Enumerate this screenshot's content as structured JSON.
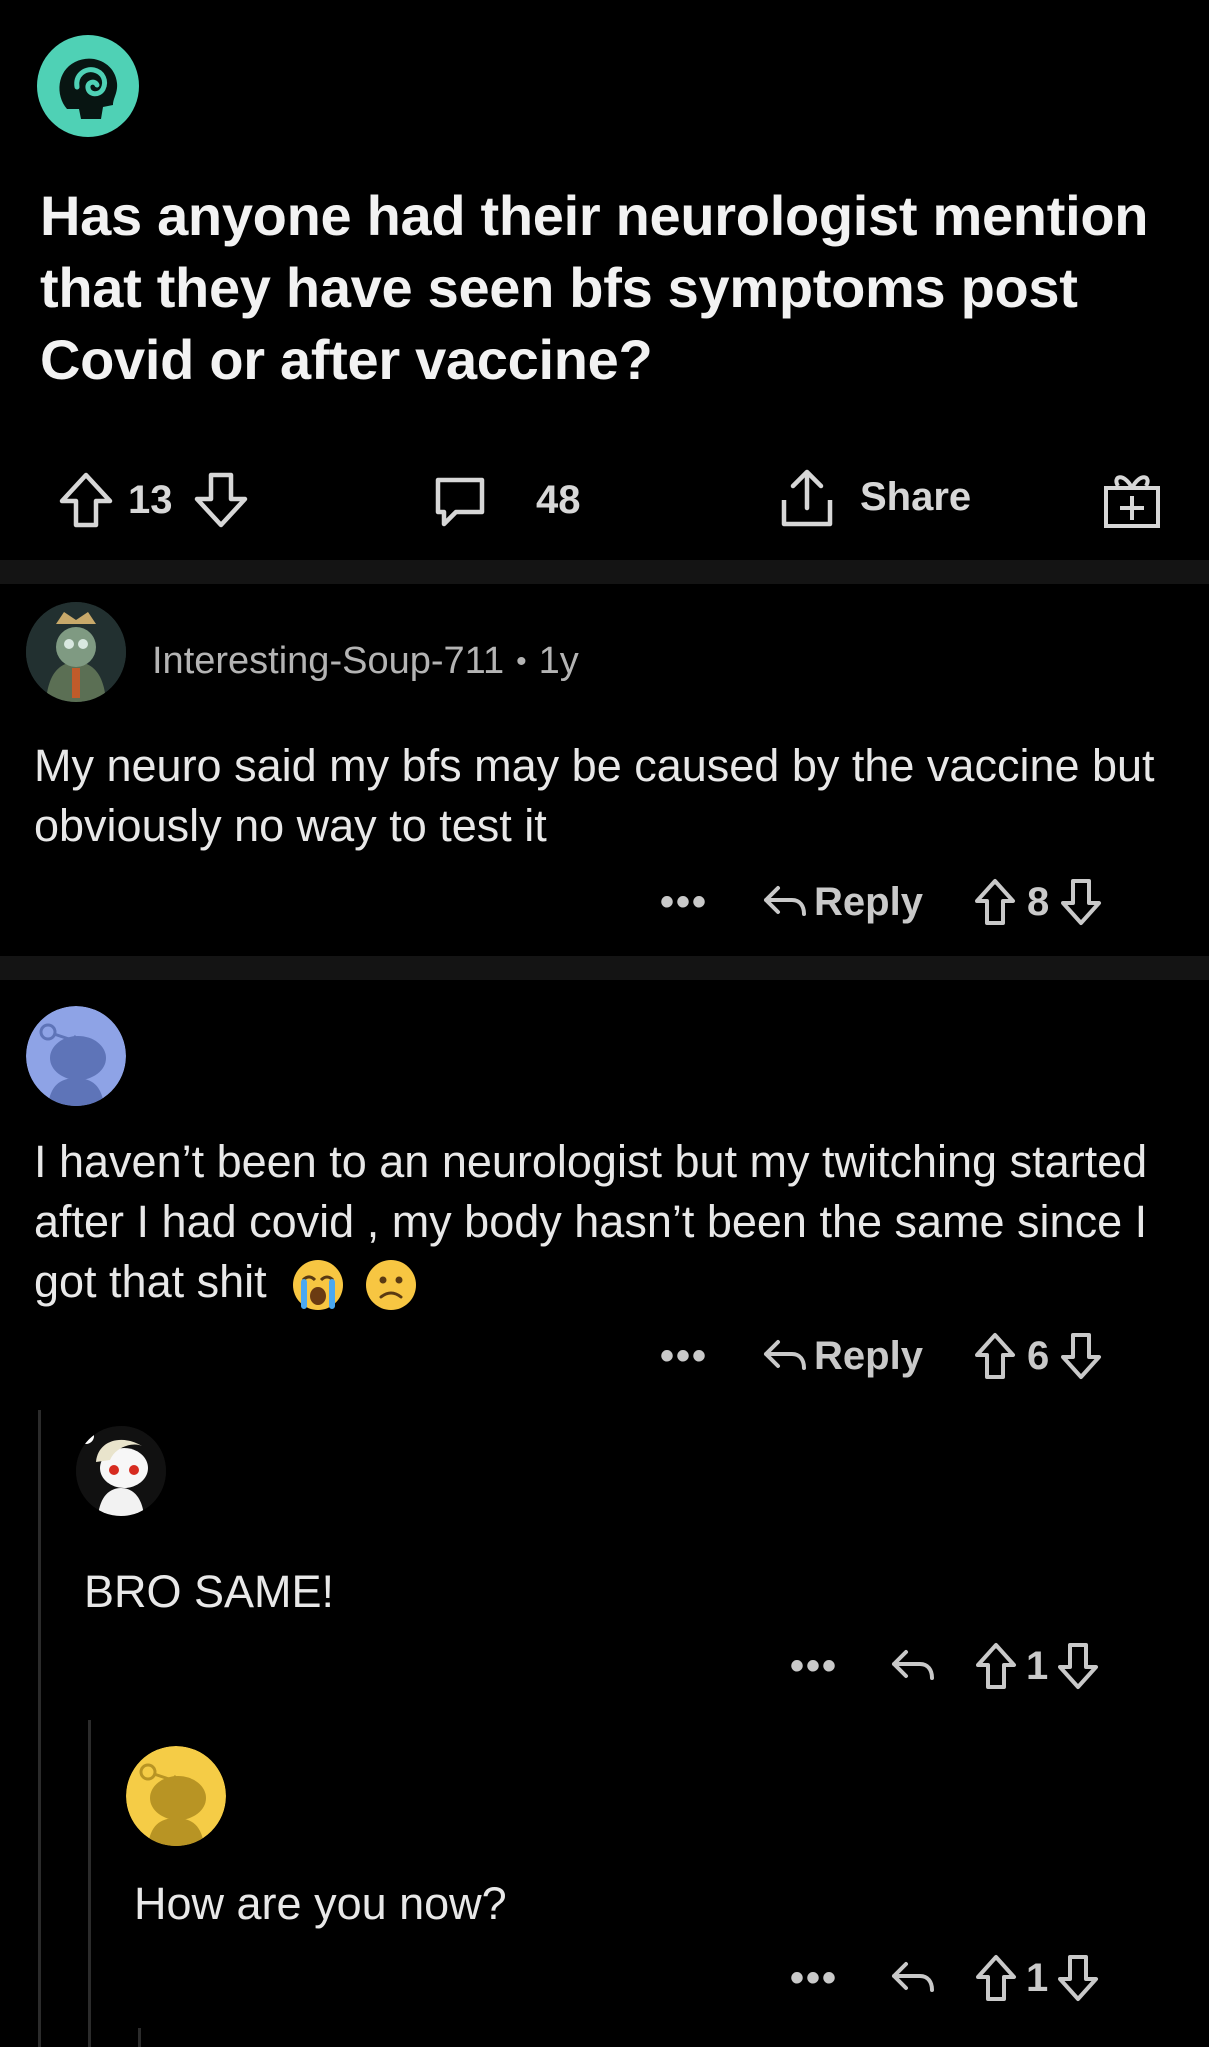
{
  "post": {
    "title": "Has anyone had their neurologist mention that they have seen bfs symptoms post Covid or after vaccine?",
    "vote_count": "13",
    "comment_count": "48",
    "share_label": "Share"
  },
  "comments": [
    {
      "username": "Interesting-Soup-711",
      "separator": "•",
      "age": "1y",
      "body": "My neuro said my bfs may be caused by the vaccine but obviously no way to test it",
      "more": "•••",
      "reply_label": "Reply",
      "votes": "8"
    },
    {
      "body": "I haven’t been to an neurologist but my twitching started after I had covid , my body hasn’t been the same since I got that shit",
      "emoji": [
        "crying-face",
        "slightly-frowning-face"
      ],
      "more": "•••",
      "reply_label": "Reply",
      "votes": "6",
      "avatar_color": "#8ea3e6"
    },
    {
      "body": "BRO SAME!",
      "more": "•••",
      "votes": "1"
    },
    {
      "body": "How are you now?",
      "more": "•••",
      "votes": "1",
      "avatar_color": "#f5cc46"
    }
  ],
  "colors": {
    "background": "#000000",
    "subreddit_icon": "#4fd1b5",
    "divider": "#141414"
  }
}
